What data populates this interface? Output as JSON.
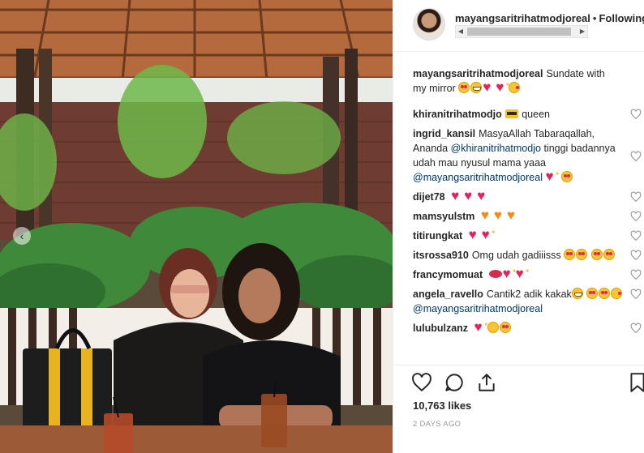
{
  "post": {
    "author": "mayangsaritrihatmodjoreal",
    "follow_separator": "•",
    "follow_status": "Following",
    "caption": {
      "user": "mayangsaritrihatmodjoreal",
      "text": "Sundate with my mirror",
      "emojis": [
        "smiling-heart-eyes-emoji",
        "grinning-emoji",
        "red-heart-emoji",
        "sparkling-heart-emoji",
        "kissing-face-emoji"
      ]
    },
    "likes": "10,763 likes",
    "timestamp": "2 DAYS AGO"
  },
  "comments": [
    {
      "user": "khiranitrihatmodjo",
      "text": "queen",
      "prefix_emoji": "crown-emoji"
    },
    {
      "user": "ingrid_kansil",
      "text": "MasyaAllah Tabaraqallah, Ananda",
      "mention": "@khiranitrihatmodjo",
      "text2": "tinggi badannya udah mau nyusul mama yaaa",
      "mention2": "@mayangsaritrihatmodjoreal"
    },
    {
      "user": "dijet78",
      "text": ""
    },
    {
      "user": "mamsyulstm",
      "text": ""
    },
    {
      "user": "titirungkat",
      "text": ""
    },
    {
      "user": "itsrossa910",
      "text": "Omg udah gadiiisss"
    },
    {
      "user": "francymomuat",
      "text": ""
    },
    {
      "user": "angela_ravello",
      "text": "Cantik2 adik kakak",
      "mention": "@mayangsaritrihatmodjoreal"
    },
    {
      "user": "lulubulzanz",
      "text": ""
    }
  ],
  "icons": {
    "like": "heart-outline-icon",
    "comment": "speech-bubble-icon",
    "share": "share-icon",
    "save": "bookmark-icon",
    "carousel_prev": "chevron-left-icon"
  },
  "colors": {
    "mention": "#003569",
    "heart": "#e0245e",
    "muted": "#999999"
  }
}
